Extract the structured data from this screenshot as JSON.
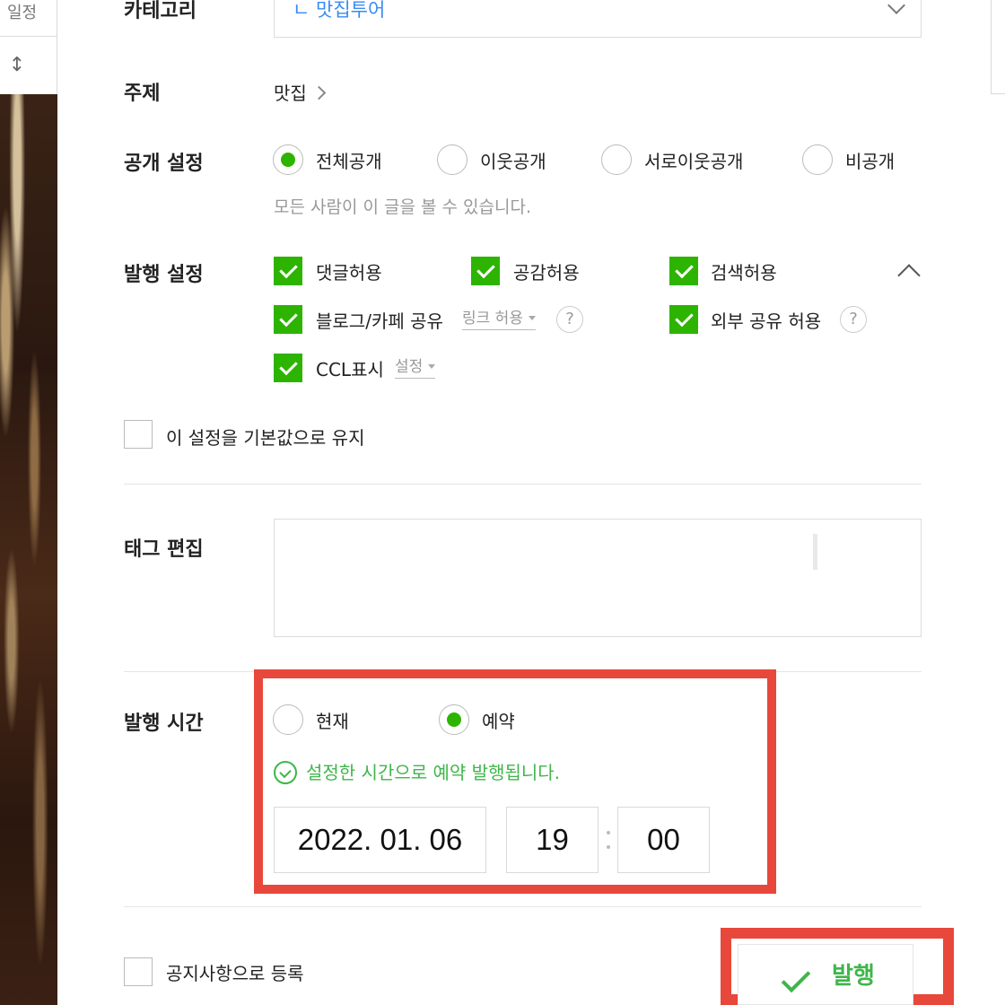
{
  "sidebar": {
    "schedule_label": "일정"
  },
  "form": {
    "category": {
      "label": "카테고리",
      "value": "ㄴ 맛집투어"
    },
    "topic": {
      "label": "주제",
      "value": "맛집"
    },
    "visibility": {
      "label": "공개 설정",
      "options": [
        "전체공개",
        "이웃공개",
        "서로이웃공개",
        "비공개"
      ],
      "selected": "전체공개",
      "helper": "모든 사람이 이 글을 볼 수 있습니다."
    },
    "publish_settings": {
      "label": "발행 설정",
      "comment": "댓글허용",
      "like": "공감허용",
      "search": "검색허용",
      "blog_cafe_share": "블로그/카페 공유",
      "link_allow": "링크 허용",
      "external_share": "외부 공유 허용",
      "ccl": "CCL표시",
      "ccl_setting": "설정",
      "help": "?"
    },
    "keep_default": "이 설정을 기본값으로 유지",
    "tags": {
      "label": "태그 편집"
    },
    "publish_time": {
      "label": "발행 시간",
      "now": "현재",
      "reserve": "예약",
      "selected": "예약",
      "message": "설정한 시간으로 예약 발행됩니다.",
      "date": "2022. 01. 06",
      "hour": "19",
      "minute": "00"
    },
    "notice_register": "공지사항으로 등록",
    "publish_button": "발행"
  },
  "colors": {
    "accent_green": "#2db400",
    "highlight_red": "#e8483b",
    "link_blue": "#3a8bf0"
  }
}
